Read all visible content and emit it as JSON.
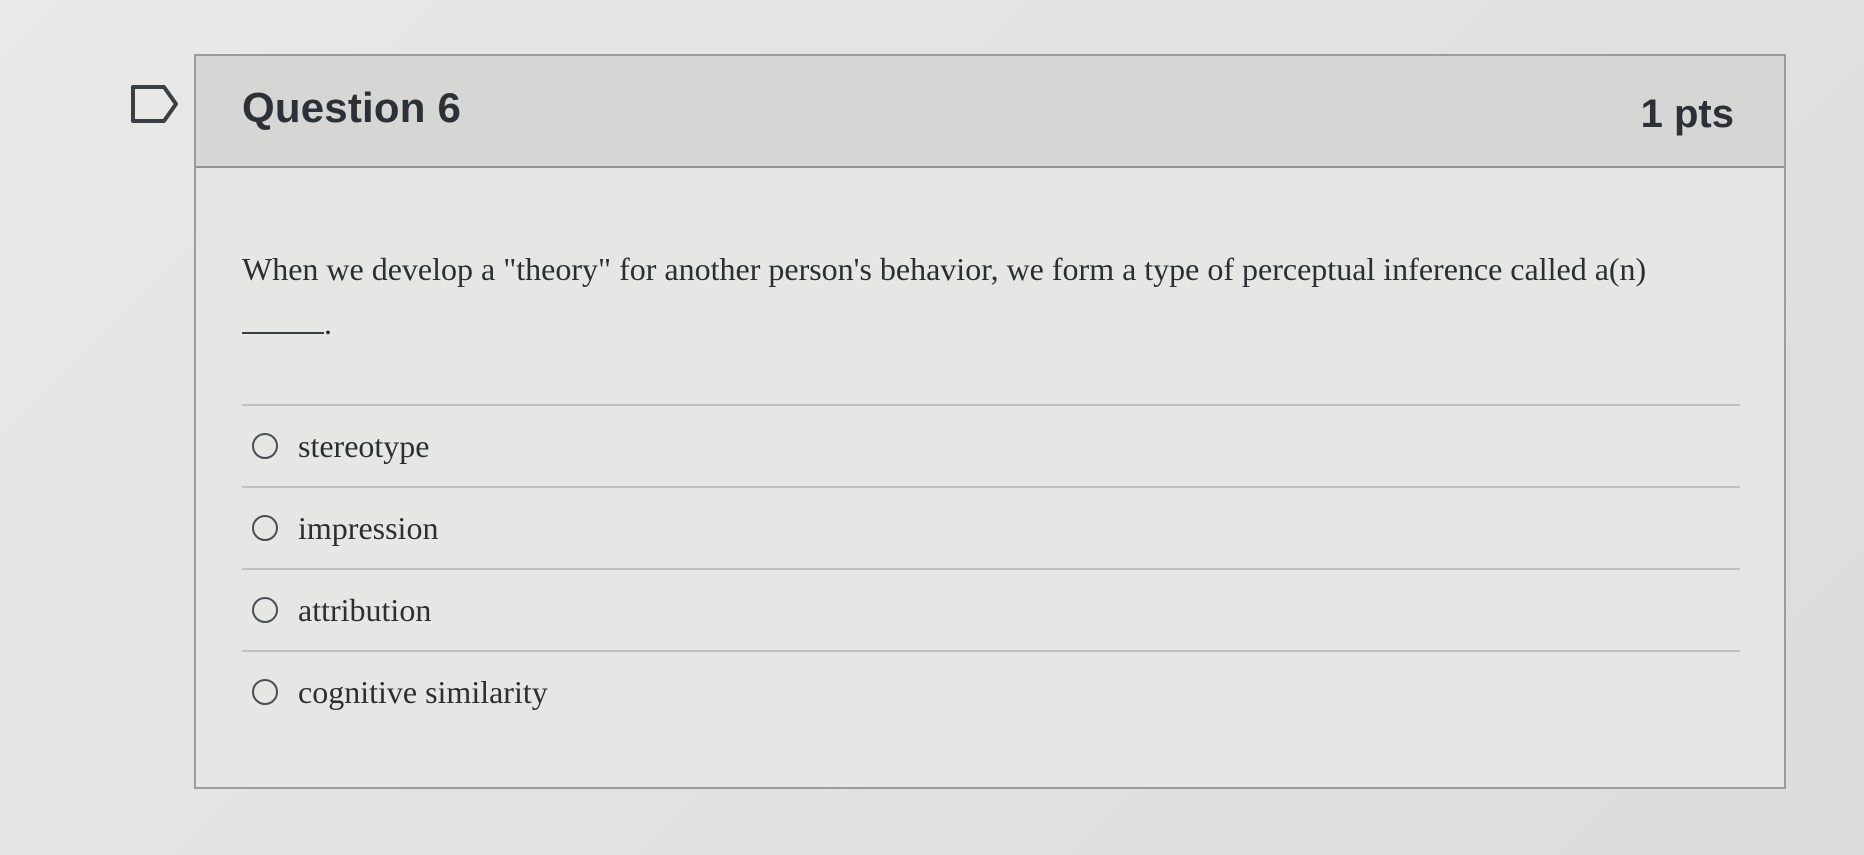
{
  "question": {
    "title": "Question 6",
    "points": "1 pts",
    "text": "When we develop a \"theory\" for another person's behavior, we form a type of perceptual inference called a(n)",
    "blank_suffix": ".",
    "flag_icon": "flag-outline-icon"
  },
  "answers": [
    {
      "label": "stereotype",
      "selected": false
    },
    {
      "label": "impression",
      "selected": false
    },
    {
      "label": "attribution",
      "selected": false
    },
    {
      "label": "cognitive similarity",
      "selected": false
    }
  ],
  "colors": {
    "header_bg": "#d6d6d4",
    "border": "#9a9c9e",
    "text": "#2a2f33"
  }
}
